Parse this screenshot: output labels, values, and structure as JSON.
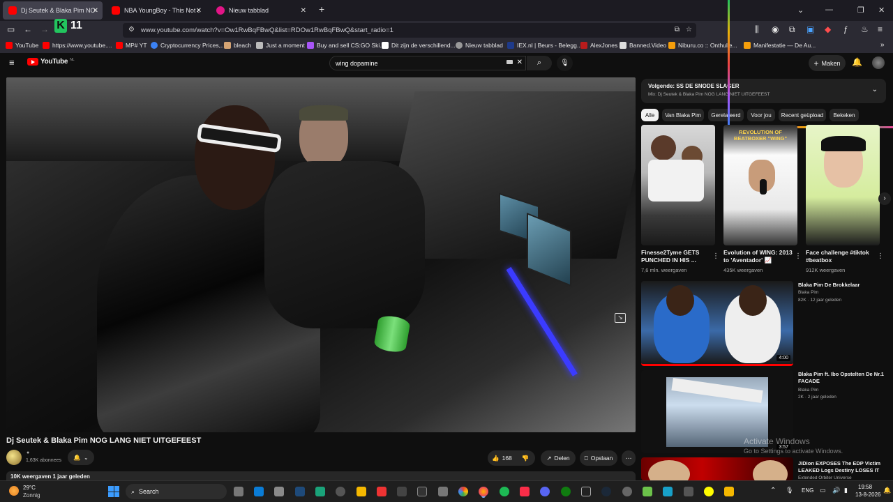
{
  "browser": {
    "tabs": [
      {
        "label": "Dj Seutek & Blaka Pim NOG LANG NIET UITGEFEEST",
        "active": true
      },
      {
        "label": "NBA YoungBoy - This Not a So",
        "active": false
      },
      {
        "label": "Nieuw tabblad",
        "active": false
      }
    ],
    "url": "www.youtube.com/watch?v=Ow1RwBqFBwQ&list=RDOw1RwBqFBwQ&start_radio=1",
    "overlay_counter": "11",
    "bookmarks": [
      "YouTube",
      "https://www.youtube....",
      "MP# YT",
      "Cryptocurrency Prices,...",
      "bleach",
      "Just a moment",
      "Buy and sell CS:GO Ski...",
      "Dit zijn de verschillend...",
      "Nieuw tabblad",
      "IEX.nl | Beurs - Belegg...",
      "AlexJones",
      "Banned.Video",
      "Niburu.co :: Onthulle...",
      "Manifestatie — De Au..."
    ]
  },
  "yt": {
    "logo": "YouTube",
    "country": "NL",
    "search_value": "wing dopamine",
    "create_label": "Maken"
  },
  "video": {
    "title": "Dj Seutek & Blaka Pim NOG LANG NIET UITGEFEEST",
    "subscribers": "1,63K abonnees",
    "likes": "168",
    "share_label": "Delen",
    "save_label": "Opslaan",
    "views_line": "10K weergaven  1 jaar geleden"
  },
  "sidebar": {
    "next_label": "Volgende: SS DE SNODE SLAGER",
    "mix_label": "Mix: Dj Seutek & Blaka Pim NOG LANG NIET UITGEFEEST",
    "chips": [
      "Alle",
      "Van Blaka Pim",
      "Gerelateerd",
      "Voor jou",
      "Recent geüpload",
      "Bekeken"
    ],
    "shorts": [
      {
        "title": "Finesse2Tyme GETS PUNCHED IN HIS ...",
        "views": "7,6 mln. weergaven"
      },
      {
        "title": "Evolution of WING: 2013 to 'Aventador' 📈",
        "views": "435K weergaven",
        "banner": "REVOLUTION OF BEATBOXER \"WING\""
      },
      {
        "title": "Face challenge #tiktok #beatbox",
        "views": "912K weergaven"
      }
    ],
    "related": [
      {
        "title": "Blaka Pim   De Brokkelaar",
        "channel": "Blaka Pim",
        "meta": "82K · 12 jaar geleden",
        "duration": "4:00"
      },
      {
        "title": "Blaka Pim ft. Ibo Opstelten    De Nr.1 FACADE",
        "channel": "Blaka Pim",
        "meta": "2K · 2 jaar geleden",
        "duration": "3:57"
      },
      {
        "title": "JiDion EXPOSES The EDP Victim LEAKED Logs  Destiny LOSES IT",
        "channel": "Extended Orbiter Universe"
      }
    ]
  },
  "windows": {
    "watermark_title": "Activate Windows",
    "watermark_sub": "Go to Settings to activate Windows.",
    "weather_temp": "29°C",
    "weather_desc": "Zonnig",
    "search_label": "Search",
    "language": "ENG",
    "time": "19:58",
    "date": "13-8-2026"
  },
  "colors": {
    "yt_red": "#ff0000",
    "yt_bg": "#0f0f0f",
    "browser_bg": "#1c1b22",
    "overlay_green": "#22c55e"
  }
}
